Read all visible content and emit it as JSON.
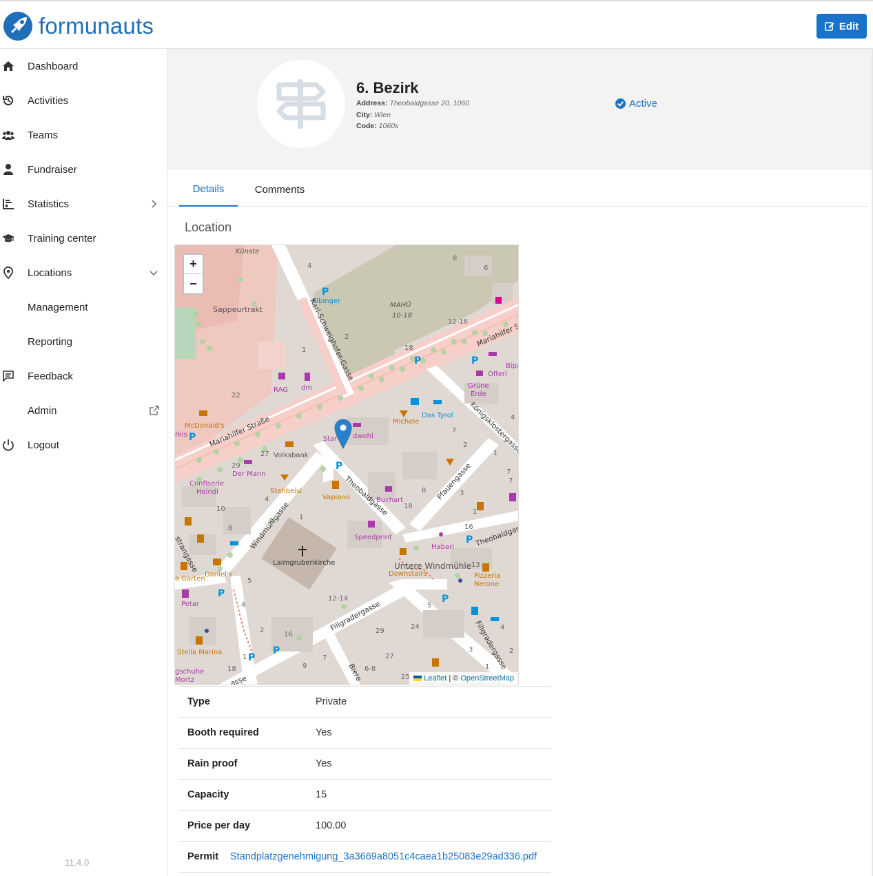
{
  "brand": {
    "name": "formunauts",
    "color": "#1e6fb8"
  },
  "header": {
    "edit_label": "Edit"
  },
  "sidebar": {
    "items": [
      {
        "label": "Dashboard",
        "icon": "home-icon"
      },
      {
        "label": "Activities",
        "icon": "history-icon"
      },
      {
        "label": "Teams",
        "icon": "users-icon"
      },
      {
        "label": "Fundraiser",
        "icon": "user-icon"
      },
      {
        "label": "Statistics",
        "icon": "chart-icon",
        "chevron": "chevron-right-icon"
      },
      {
        "label": "Training center",
        "icon": "graduation-cap-icon"
      },
      {
        "label": "Locations",
        "icon": "map-pin-icon",
        "chevron": "chevron-down-icon"
      },
      {
        "label": "Management"
      },
      {
        "label": "Reporting"
      },
      {
        "label": "Feedback",
        "icon": "message-icon"
      },
      {
        "label": "Admin",
        "icon": "external-link-icon"
      },
      {
        "label": "Logout",
        "icon": "power-icon"
      }
    ],
    "version": "11.4.0"
  },
  "location": {
    "name": "6. Bezirk",
    "address_label": "Address:",
    "address": "Theobaldgasse 20, 1060",
    "city_label": "City:",
    "city": "Wien",
    "code_label": "Code:",
    "code": "1060s",
    "status": "Active"
  },
  "tabs": {
    "details": "Details",
    "comments": "Comments"
  },
  "section": {
    "title": "Location"
  },
  "map": {
    "zoom_in": "+",
    "zoom_out": "−",
    "attribution_leaflet": "Leaflet",
    "attribution_sep": "| ©",
    "attribution_osm": "OpenStreetMap",
    "labels": {
      "mahue": "MAHÜ",
      "mahue_num": "10-18",
      "sappeur": "Sappeurtrakt",
      "elbinger": "Elbinger",
      "kunste": "Künste",
      "mariahilfer_w": "Mariahilfer Straße",
      "mariahilfer_e": "Mariahilfer St",
      "karl": "Karl-Schweighofer-Gasse",
      "koenigs": "Königsklostergasse",
      "theobald": "Theobaldgasse",
      "theobald_e": "Theobaldgasse",
      "pfauen": "Pfauengasse",
      "windmuehl": "Windmühlgasse",
      "fillgrader": "Fillgradergasse",
      "fillgrader_e": "Fillgradergasse",
      "laimgruben": "Laimgrubenkirche",
      "untere": "Untere Windmühle",
      "rag": "RAG",
      "dm": "dm",
      "mcdonalds": "McDonald's",
      "volksbank": "Volksbank",
      "der_mann": "Der Mann",
      "confiserie": "Confiserie",
      "heindl": "Heindl",
      "stehbeisl": "Stehbeisl",
      "vapiano": "Vapiano",
      "buchart": "Buchart",
      "speedprint": "Speedprint",
      "downstairs": "Downstairs",
      "habari": "Habari",
      "pizzeria": "Pizzeria",
      "nerone": "Nerone",
      "michele": "Michele",
      "das_tyrol": "Das Tyrol",
      "grune": "Grüne",
      "erde": "Erde",
      "offerl": "Offerl",
      "bipa": "Bipa",
      "danielas": "Daniel's",
      "stella": "Stella Marina",
      "petar": "Petar",
      "garten": "a Garten",
      "schuhe": "gschuhe",
      "mortz": "Mortz",
      "star": "Star",
      "dwohl": "dwohl",
      "markis": "rkis",
      "strangasse": "strangasse",
      "asse": "asse",
      "biere": "Biere",
      "n4": "4",
      "n8": "8",
      "n6": "6",
      "n2": "2",
      "n1": "1",
      "n18": "18",
      "n1216": "12-16",
      "n22": "22",
      "n27": "27",
      "n29": "29",
      "n4b": "4",
      "n10": "10",
      "n8b": "8",
      "n18b": "18",
      "n8c": "8",
      "n3": "3",
      "n16": "16",
      "n1b": "1",
      "n7": "7",
      "n13": "13",
      "n5": "5",
      "n4c": "4",
      "n2b": "2",
      "n16b": "16",
      "n1214": "12-14",
      "n7b": "7",
      "n29b": "29",
      "n24": "24",
      "n27b": "27",
      "n68": "6-8",
      "n25": "25",
      "n9": "9",
      "n18c": "18",
      "n1c": "1",
      "n5b": "5",
      "n4d": "4",
      "n3b": "3",
      "n2c": "2",
      "n1d": "1",
      "n2d": "2",
      "n7c": "7",
      "n1e": "1",
      "n7d": "7",
      "n4e": "4",
      "n1f": "1"
    }
  },
  "details": [
    {
      "label": "Type",
      "value": "Private"
    },
    {
      "label": "Booth required",
      "value": "Yes"
    },
    {
      "label": "Rain proof",
      "value": "Yes"
    },
    {
      "label": "Capacity",
      "value": "15"
    },
    {
      "label": "Price per day",
      "value": "100.00"
    }
  ],
  "permit": {
    "label": "Permit",
    "file": "Standplatzgenehmigung_3a3669a8051c4caea1b25083e29ad336.pdf"
  },
  "colors": {
    "accent": "#1a73c8",
    "status": "#1a73c8"
  }
}
